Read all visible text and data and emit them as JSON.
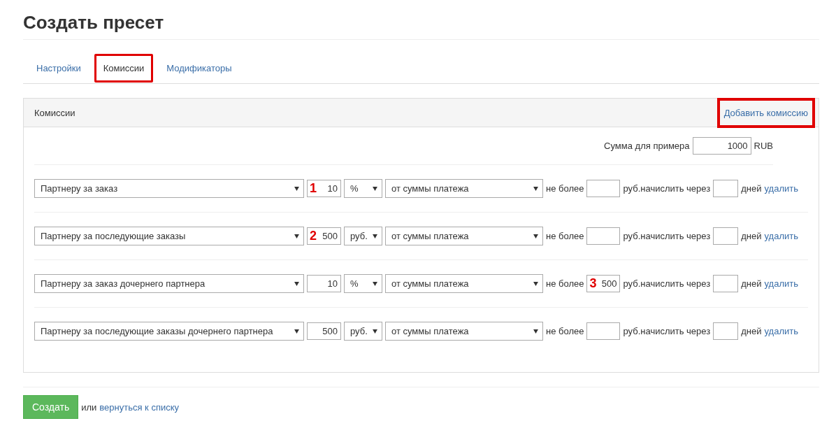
{
  "title": "Создать пресет",
  "tabs": [
    {
      "label": "Настройки",
      "selected": false,
      "highlighted": false
    },
    {
      "label": "Комиссии",
      "selected": true,
      "highlighted": true
    },
    {
      "label": "Модификаторы",
      "selected": false,
      "highlighted": false
    }
  ],
  "panel": {
    "title": "Комиссии",
    "add_link": {
      "label": "Добавить комиссию",
      "highlighted": true
    },
    "example": {
      "label": "Сумма для примера",
      "value": "1000",
      "currency": "RUB"
    },
    "rows": [
      {
        "type": "Партнеру за заказ",
        "amount": "10",
        "unit": "%",
        "base": "от суммы платежа",
        "max_label": "не более",
        "max": "",
        "after_label": "руб.начислить через",
        "days": "",
        "days_label": "дней",
        "delete": "удалить",
        "amount_marker": "1"
      },
      {
        "type": "Партнеру за последующие заказы",
        "amount": "500",
        "unit": "руб.",
        "base": "от суммы платежа",
        "max_label": "не более",
        "max": "",
        "after_label": "руб.начислить через",
        "days": "",
        "days_label": "дней",
        "delete": "удалить",
        "amount_marker": "2"
      },
      {
        "type": "Партнеру за заказ дочернего партнера",
        "amount": "10",
        "unit": "%",
        "base": "от суммы платежа",
        "max_label": "не более",
        "max": "500",
        "after_label": "руб.начислить через",
        "days": "",
        "days_label": "дней",
        "delete": "удалить",
        "max_marker": "3"
      },
      {
        "type": "Партнеру за последующие заказы дочернего партнера",
        "amount": "500",
        "unit": "руб.",
        "base": "от суммы платежа",
        "max_label": "не более",
        "max": "",
        "after_label": "руб.начислить через",
        "days": "",
        "days_label": "дней",
        "delete": "удалить"
      }
    ]
  },
  "footer": {
    "submit": "Создать",
    "or_text": "или",
    "back_link": "вернуться к списку"
  }
}
